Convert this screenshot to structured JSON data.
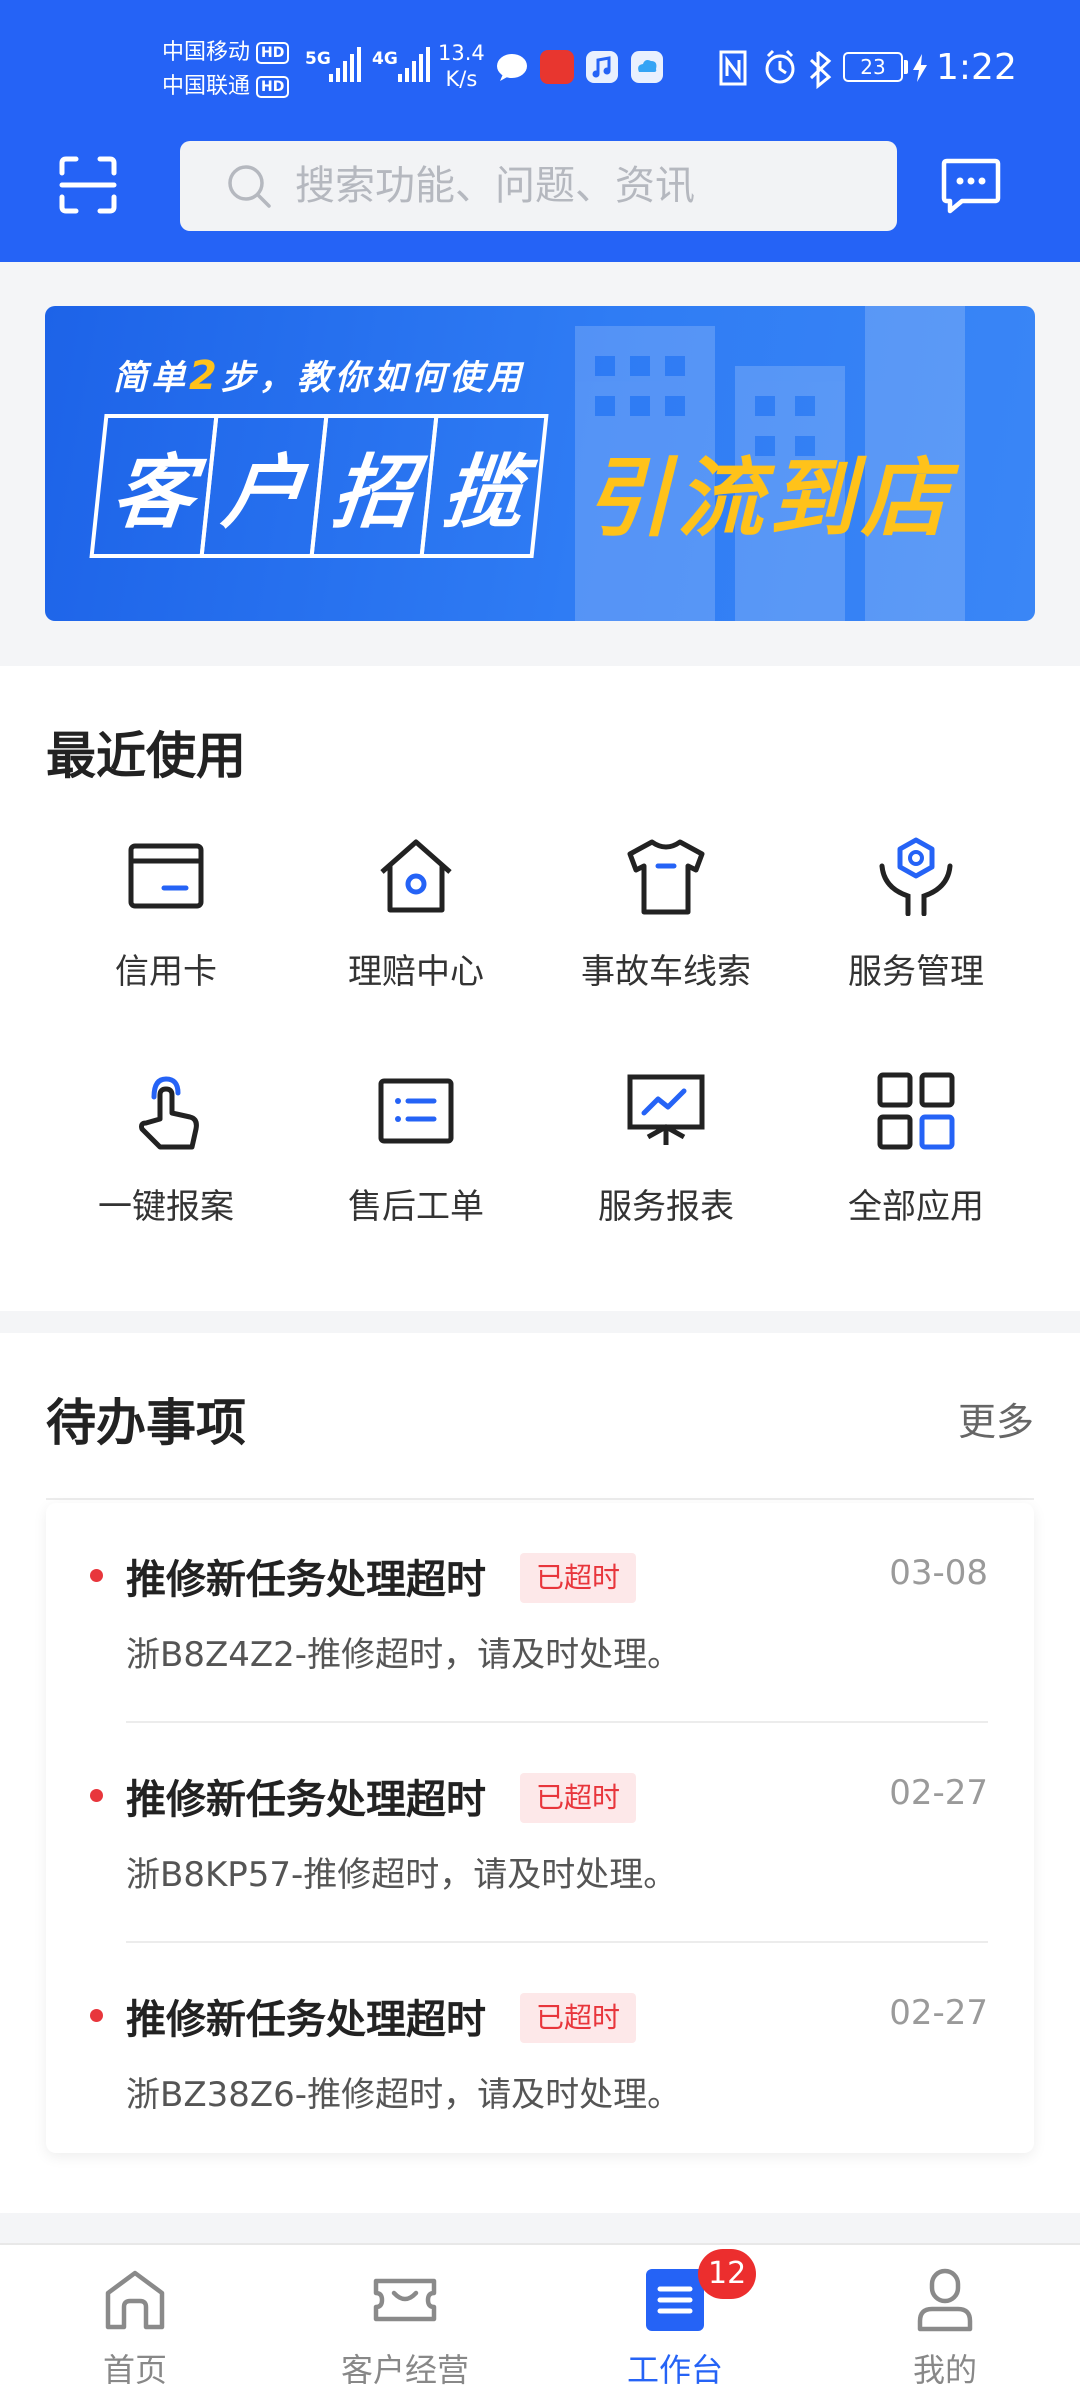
{
  "status_bar": {
    "carrier1": "中国移动",
    "carrier2": "中国联通",
    "hd": "HD",
    "net_type1": "5G",
    "net_type2": "4G",
    "net_speed_value": "13.4",
    "net_speed_unit": "K/s",
    "battery": "23",
    "time": "1:22"
  },
  "header": {
    "search_placeholder": "搜索功能、问题、资讯"
  },
  "banner": {
    "subtitle_prefix": "简单",
    "subtitle_num": "2",
    "subtitle_suffix": "步，教你如何使用",
    "boxes": [
      "客",
      "户",
      "招",
      "揽"
    ],
    "highlight": "引流到店"
  },
  "recent": {
    "title": "最近使用",
    "items": [
      {
        "label": "信用卡",
        "icon": "credit-card-icon"
      },
      {
        "label": "理赔中心",
        "icon": "claim-center-icon"
      },
      {
        "label": "事故车线索",
        "icon": "accident-car-lead-icon"
      },
      {
        "label": "服务管理",
        "icon": "service-management-icon"
      },
      {
        "label": "一键报案",
        "icon": "one-click-report-icon"
      },
      {
        "label": "售后工单",
        "icon": "after-sales-order-icon"
      },
      {
        "label": "服务报表",
        "icon": "service-report-icon"
      },
      {
        "label": "全部应用",
        "icon": "all-apps-icon"
      }
    ]
  },
  "todo": {
    "title": "待办事项",
    "more": "更多",
    "items": [
      {
        "title": "推修新任务处理超时",
        "badge": "已超时",
        "date": "03-08",
        "desc": "浙B8Z4Z2-推修超时，请及时处理。"
      },
      {
        "title": "推修新任务处理超时",
        "badge": "已超时",
        "date": "02-27",
        "desc": "浙B8KP57-推修超时，请及时处理。"
      },
      {
        "title": "推修新任务处理超时",
        "badge": "已超时",
        "date": "02-27",
        "desc": "浙BZ38Z6-推修超时，请及时处理。"
      }
    ]
  },
  "bottom_nav": {
    "items": [
      {
        "label": "首页",
        "icon": "home-icon"
      },
      {
        "label": "客户经营",
        "icon": "customer-ticket-icon"
      },
      {
        "label": "工作台",
        "icon": "workbench-icon",
        "badge": "12"
      },
      {
        "label": "我的",
        "icon": "profile-icon"
      }
    ],
    "active_index": 2
  },
  "colors": {
    "brand": "#2563f6",
    "accent_yellow": "#ffc21a",
    "alert_red": "#e8363c"
  }
}
